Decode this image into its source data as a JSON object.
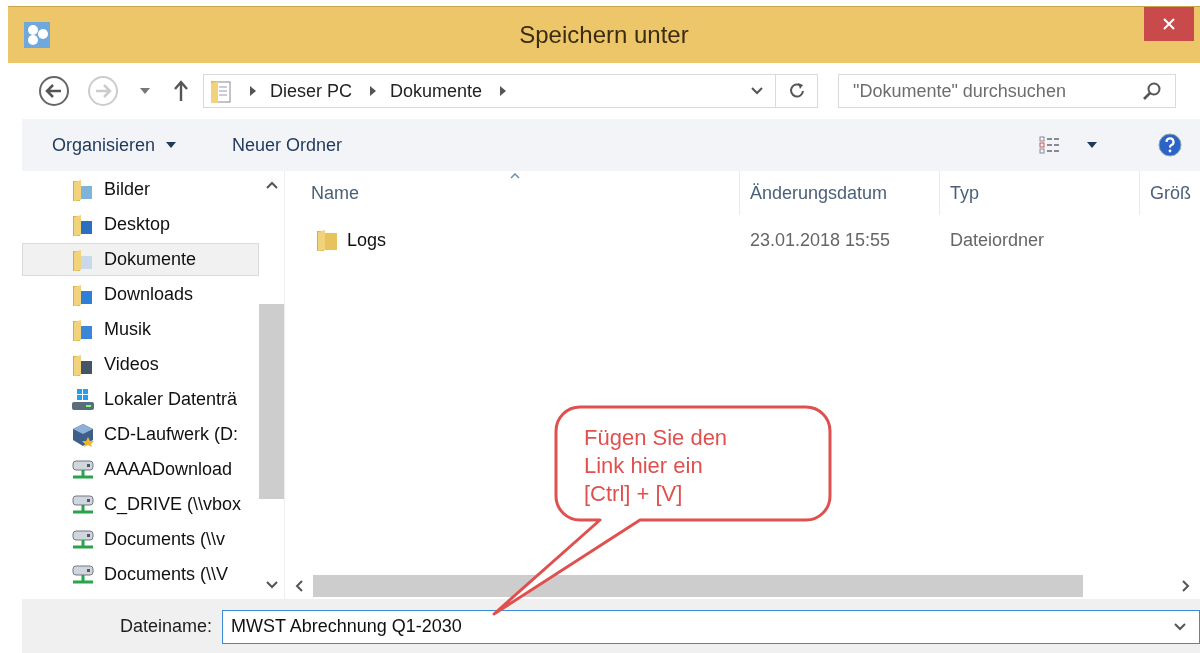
{
  "window": {
    "title": "Speichern unter"
  },
  "address": {
    "crumbs": [
      "Dieser PC",
      "Dokumente"
    ]
  },
  "search": {
    "placeholder": "\"Dokumente\" durchsuchen"
  },
  "commands": {
    "organize": "Organisieren",
    "new_folder": "Neuer Ordner"
  },
  "sidebar": {
    "items": [
      {
        "label": "Bilder",
        "kind": "pictures",
        "selected": false
      },
      {
        "label": "Desktop",
        "kind": "desktop",
        "selected": false
      },
      {
        "label": "Dokumente",
        "kind": "documents",
        "selected": true
      },
      {
        "label": "Downloads",
        "kind": "downloads",
        "selected": false
      },
      {
        "label": "Musik",
        "kind": "music",
        "selected": false
      },
      {
        "label": "Videos",
        "kind": "videos",
        "selected": false
      },
      {
        "label": "Lokaler Datenträ",
        "kind": "drive",
        "selected": false
      },
      {
        "label": "CD-Laufwerk (D:",
        "kind": "cd",
        "selected": false
      },
      {
        "label": "AAAADownload",
        "kind": "network",
        "selected": false
      },
      {
        "label": "C_DRIVE (\\\\vbox",
        "kind": "network",
        "selected": false
      },
      {
        "label": "Documents (\\\\v",
        "kind": "network",
        "selected": false
      },
      {
        "label": "Documents (\\\\V",
        "kind": "network",
        "selected": false
      }
    ]
  },
  "table": {
    "columns": [
      "Name",
      "Änderungsdatum",
      "Typ",
      "Größ"
    ],
    "rows": [
      {
        "name": "Logs",
        "date": "23.01.2018 15:55",
        "type": "Dateiordner"
      }
    ]
  },
  "filename": {
    "label": "Dateiname:",
    "value": "MWST Abrechnung Q1-2030"
  },
  "callout": {
    "text": "Fügen Sie den\nLink hier ein\n[Ctrl] + [V]"
  }
}
